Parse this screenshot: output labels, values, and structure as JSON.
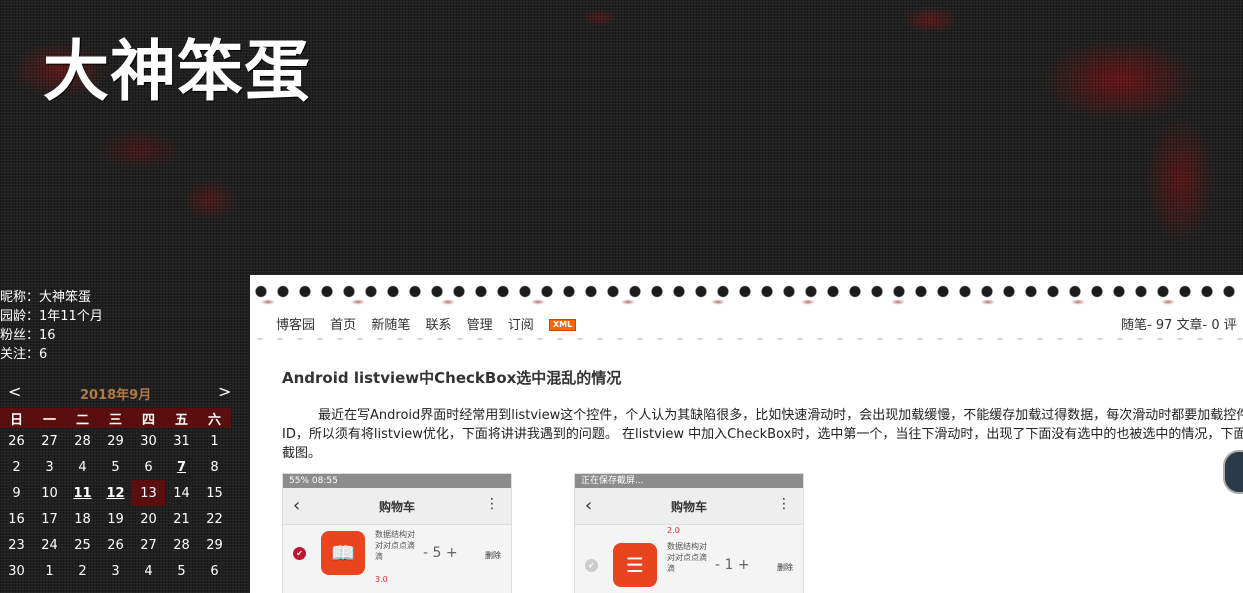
{
  "site": {
    "title": "大神笨蛋"
  },
  "profile": {
    "nickname": "昵称：大神笨蛋",
    "age": "园龄：1年11个月",
    "fans": "粉丝：16",
    "follow": "关注：6"
  },
  "calendar": {
    "prev": "<",
    "next": ">",
    "month": "2018年9月",
    "weekdays": [
      "日",
      "一",
      "二",
      "三",
      "四",
      "五",
      "六"
    ],
    "weeks": [
      [
        "26",
        "27",
        "28",
        "29",
        "30",
        "31",
        "1"
      ],
      [
        "2",
        "3",
        "4",
        "5",
        "6",
        "7",
        "8"
      ],
      [
        "9",
        "10",
        "11",
        "12",
        "13",
        "14",
        "15"
      ],
      [
        "16",
        "17",
        "18",
        "19",
        "20",
        "21",
        "22"
      ],
      [
        "23",
        "24",
        "25",
        "26",
        "27",
        "28",
        "29"
      ],
      [
        "30",
        "1",
        "2",
        "3",
        "4",
        "5",
        "6"
      ]
    ]
  },
  "nav": {
    "items": [
      "博客园",
      "首页",
      "新随笔",
      "联系",
      "管理",
      "订阅"
    ],
    "xml": "XML",
    "stats": "随笔- 97  文章- 0  评"
  },
  "post": {
    "title": "Android listview中CheckBox选中混乱的情况",
    "body_line1": "最近在写Android界面时经常用到listview这个控件，个人认为其缺陷很多，比如快速滑动时，会出现加载缓慢，不能缓存加载过得数据，每次滑动时都要加载控件",
    "body_line2": "ID，所以须有将listview优化，下面将讲讲我遇到的问题。 在listview 中加入CheckBox时，选中第一个，当往下滑动时，出现了下面没有选中的也被选中的情况，下面",
    "body_line3": "截图。"
  },
  "screenshot1": {
    "status": "55% 08:55",
    "title": "购物车",
    "item_name": "数据结构对对对点点滴滴",
    "qty": "- 5 +",
    "delete": "删除",
    "price": "3.0"
  },
  "screenshot2": {
    "status": "正在保存截屏...",
    "title": "购物车",
    "price_top": "2.0",
    "item_name": "数据结构对对对点点滴滴",
    "qty": "- 1 +",
    "delete": "删除"
  }
}
